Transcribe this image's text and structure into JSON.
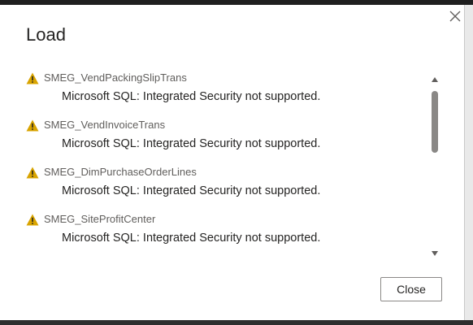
{
  "dialog": {
    "title": "Load",
    "close_icon": "close-x-icon",
    "close_button_label": "Close"
  },
  "items": [
    {
      "icon": "warning-icon",
      "name": "SMEG_VendPackingSlipTrans",
      "message": "Microsoft SQL: Integrated Security not supported."
    },
    {
      "icon": "warning-icon",
      "name": "SMEG_VendInvoiceTrans",
      "message": "Microsoft SQL: Integrated Security not supported."
    },
    {
      "icon": "warning-icon",
      "name": "SMEG_DimPurchaseOrderLines",
      "message": "Microsoft SQL: Integrated Security not supported."
    },
    {
      "icon": "warning-icon",
      "name": "SMEG_SiteProfitCenter",
      "message": "Microsoft SQL: Integrated Security not supported."
    }
  ],
  "colors": {
    "warning": "#d9a400",
    "text_primary": "#252423",
    "text_secondary": "#605e5c",
    "scrollbar_thumb": "#8a8886"
  }
}
